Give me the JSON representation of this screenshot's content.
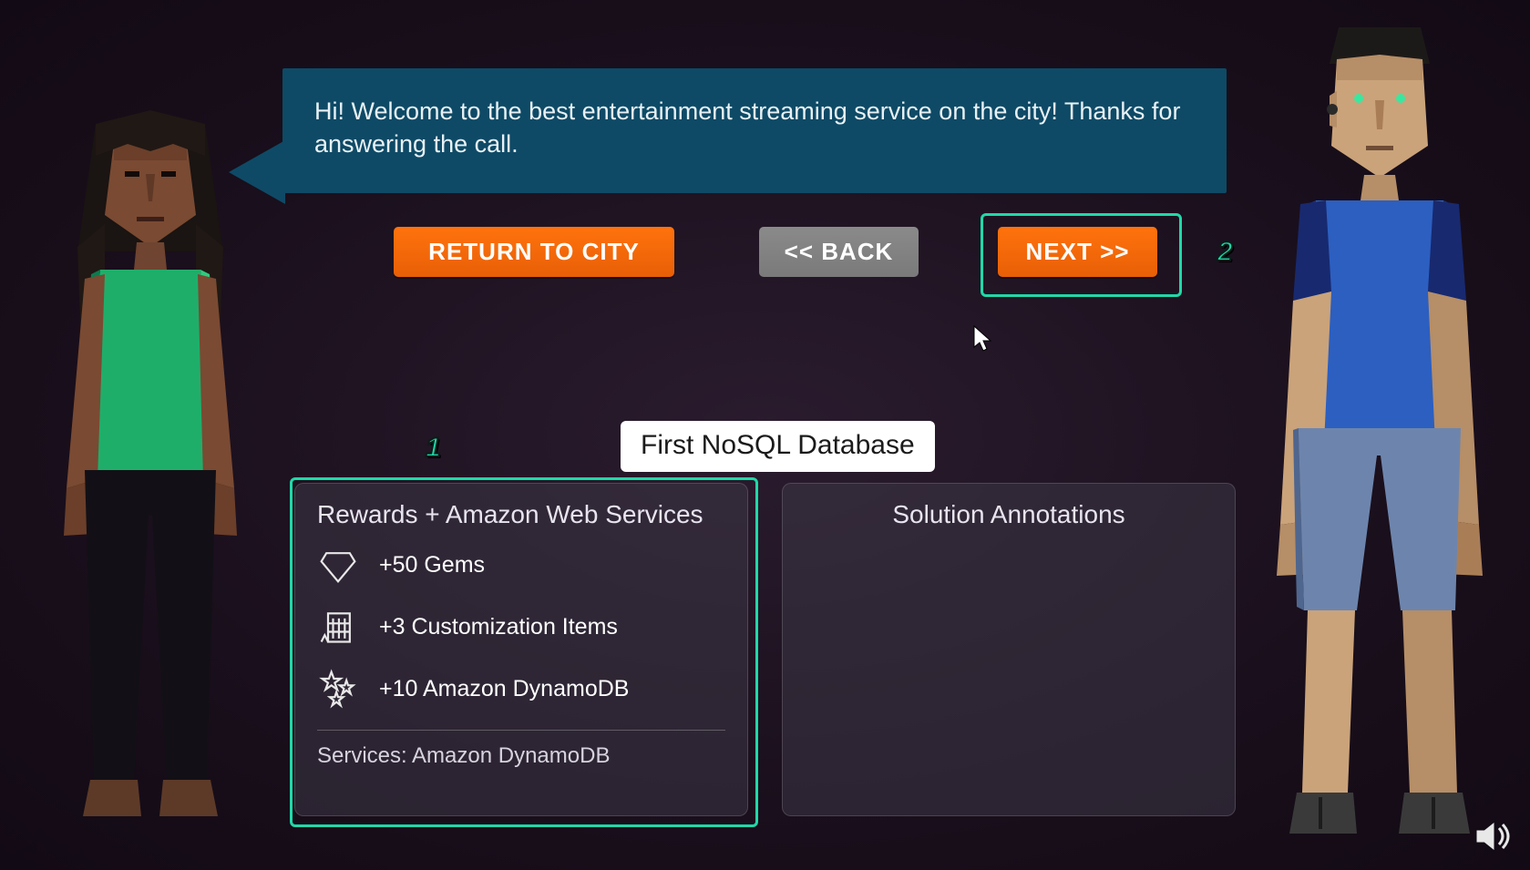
{
  "dialogue": {
    "text": "Hi! Welcome to the best entertainment streaming service on the city! Thanks for answering the call."
  },
  "buttons": {
    "return": "RETURN TO CITY",
    "back": "<< BACK",
    "next": "NEXT >>"
  },
  "steps": {
    "one": "1",
    "two": "2"
  },
  "title_chip": "First NoSQL Database",
  "rewards": {
    "heading": "Rewards + Amazon Web Services",
    "items": [
      {
        "icon": "gem-icon",
        "label": "+50 Gems"
      },
      {
        "icon": "building-icon",
        "label": "+3 Customization Items"
      },
      {
        "icon": "stars-icon",
        "label": "+10 Amazon DynamoDB"
      }
    ],
    "services_line": "Services: Amazon DynamoDB"
  },
  "solutions": {
    "heading": "Solution Annotations"
  },
  "colors": {
    "accent_teal": "#20d9a8",
    "accent_orange": "#ff730d",
    "speech_bg": "#0e4a66"
  }
}
